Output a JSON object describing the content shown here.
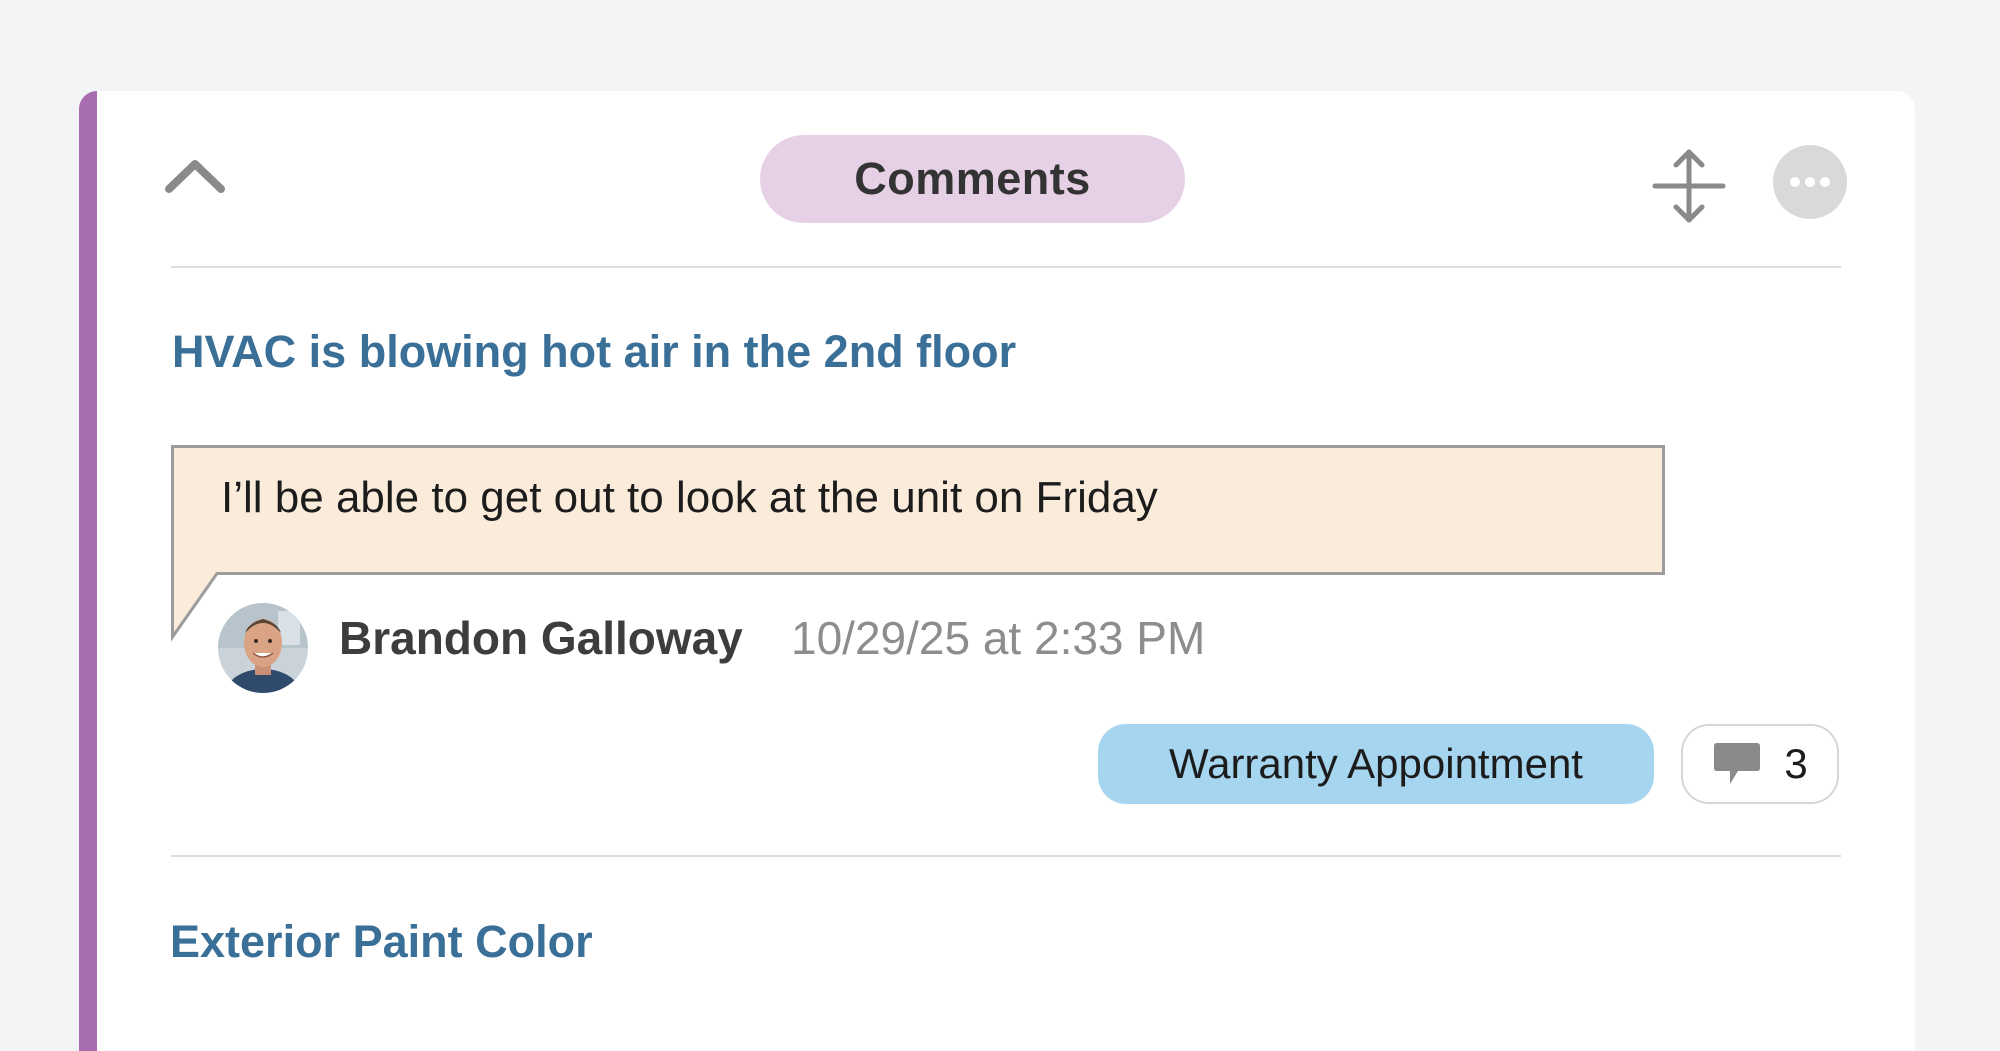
{
  "colors": {
    "accent": "#a86cb1",
    "title_pill_bg": "#e6d0e6",
    "bubble_bg": "#fbebda",
    "bubble_border": "#9c9c9c",
    "tag_bg": "#a6d5ef",
    "link": "#3a6f98"
  },
  "header": {
    "title": "Comments",
    "collapse_icon": "chevron-up-icon",
    "expand_icon": "expand-vertical-icon",
    "more_icon": "more-horizontal-icon"
  },
  "threads": [
    {
      "title": "HVAC is blowing hot air in the 2nd floor",
      "comment": {
        "text": "I’ll be able to get out to look at the unit on Friday",
        "author": "Brandon Galloway",
        "timestamp": "10/29/25 at 2:33 PM",
        "avatar_icon": "user-avatar"
      },
      "tag": "Warranty Appointment",
      "reply_count": "3",
      "reply_icon": "comment-bubble-icon"
    },
    {
      "title": "Exterior Paint Color"
    }
  ]
}
